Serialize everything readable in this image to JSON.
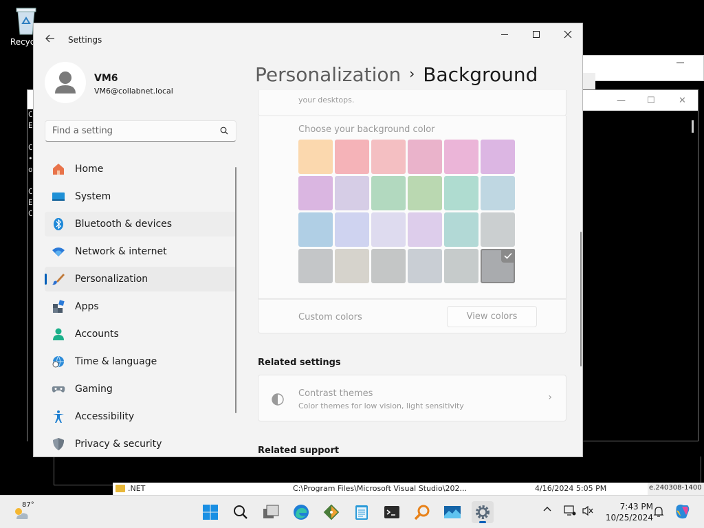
{
  "desktop": {
    "recycle_bin_label": "Recycle",
    "console_lines": [
      "C",
      "E",
      "",
      "C",
      "•",
      "o",
      "",
      "C",
      "E",
      "C"
    ]
  },
  "settings": {
    "app_title": "Settings",
    "user": {
      "name": "VM6",
      "email": "VM6@collabnet.local"
    },
    "search": {
      "placeholder": "Find a setting"
    },
    "nav": [
      {
        "label": "Home",
        "icon": "home-icon"
      },
      {
        "label": "System",
        "icon": "system-icon"
      },
      {
        "label": "Bluetooth & devices",
        "icon": "bluetooth-icon"
      },
      {
        "label": "Network & internet",
        "icon": "wifi-icon"
      },
      {
        "label": "Personalization",
        "icon": "paintbrush-icon",
        "selected": true
      },
      {
        "label": "Apps",
        "icon": "apps-icon"
      },
      {
        "label": "Accounts",
        "icon": "accounts-icon"
      },
      {
        "label": "Time & language",
        "icon": "globe-clock-icon"
      },
      {
        "label": "Gaming",
        "icon": "gamepad-icon"
      },
      {
        "label": "Accessibility",
        "icon": "accessibility-icon"
      },
      {
        "label": "Privacy & security",
        "icon": "shield-icon"
      }
    ],
    "breadcrumb": {
      "parent": "Personalization",
      "separator": "›",
      "current": "Background"
    },
    "desktops_text": "your desktops.",
    "background_color": {
      "title": "Choose your background color",
      "swatches": [
        "#fbd8ae",
        "#f5b3b8",
        "#f4bfc2",
        "#eab3cb",
        "#ebb5d8",
        "#dcb6e3",
        "#dab6e1",
        "#d6cde6",
        "#b2d9bf",
        "#bad8b1",
        "#afdcd0",
        "#bfd7e2",
        "#b0cfe5",
        "#cfd3f0",
        "#dedbef",
        "#ddcdeb",
        "#b2d9d6",
        "#cbcfd0",
        "#c4c6c8",
        "#d6d3cc",
        "#c4c6c6",
        "#c9ced4",
        "#c6cbcb",
        "#a9abae"
      ],
      "selected_index": 23,
      "custom_label": "Custom colors",
      "view_button": "View colors"
    },
    "related_settings": {
      "heading": "Related settings",
      "contrast_title": "Contrast themes",
      "contrast_sub": "Color themes for low vision, light sensitivity"
    },
    "related_support_heading": "Related support"
  },
  "explorer_row": {
    "name": ".NET",
    "path": "C:\\Program Files\\Microsoft Visual Studio\\202...",
    "modified": "4/16/2024 5:05 PM",
    "side_text": "e.240308-1400"
  },
  "taskbar": {
    "temperature": "87°",
    "time": "7:43 PM",
    "date": "10/25/2024",
    "apps": [
      "start-icon",
      "search-icon",
      "task-view-icon",
      "edge-icon",
      "git-icon",
      "notepad-icon",
      "terminal-icon",
      "magnifier-icon",
      "photos-icon",
      "settings-icon"
    ]
  },
  "colors": {
    "accent": "#005fb8"
  }
}
